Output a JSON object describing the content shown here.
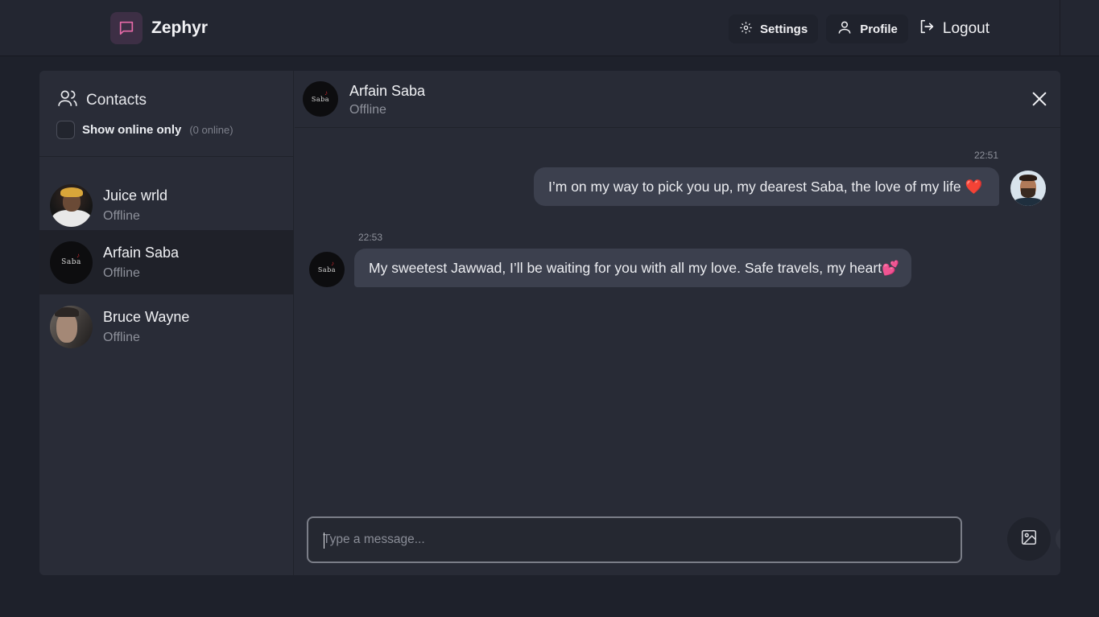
{
  "app": {
    "name": "Zephyr"
  },
  "nav": {
    "settings": "Settings",
    "profile": "Profile",
    "logout": "Logout"
  },
  "sidebar": {
    "title": "Contacts",
    "online_filter_label": "Show online only",
    "online_count": "(0 online)",
    "contacts": [
      {
        "name": "Juice wrld",
        "status": "Offline"
      },
      {
        "name": "Arfain Saba",
        "status": "Offline"
      },
      {
        "name": "Bruce Wayne",
        "status": "Offline"
      }
    ]
  },
  "chat": {
    "contact_name": "Arfain Saba",
    "contact_status": "Offline",
    "messages": [
      {
        "time": "22:51",
        "text": "I’m on my way to pick you up, my dearest Saba, the love of my life ❤️"
      },
      {
        "time": "22:53",
        "text": "My sweetest Jawwad, I’ll be waiting for you with all my love. Safe travels, my heart💕"
      }
    ],
    "composer_placeholder": "Type a message..."
  },
  "avatar_text": "Saba",
  "colors": {
    "accent": "#e86aa8",
    "background": "#1e212b",
    "bubble": "#3c404e",
    "heart": "#e0242f"
  },
  "icons": [
    "message-square-icon",
    "gear-icon",
    "user-icon",
    "logout-icon",
    "users-icon",
    "close-icon",
    "image-icon",
    "send-icon"
  ]
}
